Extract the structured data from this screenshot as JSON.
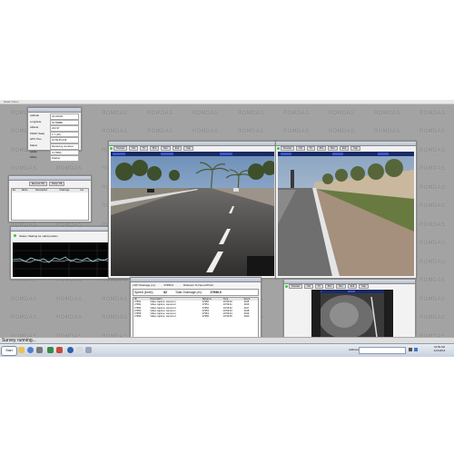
{
  "window": {
    "title": "Hawk Vision"
  },
  "watermark": "ROMDAS",
  "gps": {
    "rows": [
      {
        "label": "Latitude",
        "value": "24.3431N"
      },
      {
        "label": "Longitude",
        "value": "54.5998E"
      },
      {
        "label": "Altitude",
        "value": "243.97"
      },
      {
        "label": "PDOP (Sats)",
        "value": "1.7 (10)"
      },
      {
        "label": "GPS Time",
        "value": "10:59:45.246"
      },
      {
        "label": "Status",
        "value": "Receiving numbers"
      },
      {
        "label": "Lanes",
        "value": "3 (7000)"
      },
      {
        "label": "Offset",
        "value": "Flasher"
      }
    ]
  },
  "events": {
    "tabs": [
      "Element: PE",
      "Rutup: PE"
    ],
    "columns": [
      "Ev.",
      "Name",
      "Description",
      "Chainage",
      "Lat"
    ]
  },
  "status_window": {
    "status_text": "Status: Waiting for valid position"
  },
  "camera_left": {
    "buttons": [
      "Preview",
      "Vid",
      "Ttl",
      "Pho",
      "Rec",
      "Exit",
      "Cap"
    ]
  },
  "camera_right": {
    "buttons": [
      "Preview",
      "Vid",
      "Ttl",
      "Pho",
      "Rec",
      "Exit",
      "Cap"
    ]
  },
  "camera_bottom": {
    "buttons": [
      "Preview",
      "Vid",
      "Ttl",
      "Pho",
      "Rec",
      "Exit",
      "Cap"
    ]
  },
  "log": {
    "lsp_label": "LSP Chainage (m):",
    "lsp_value": "27956.0",
    "distance_label": "Distance To Next A/Point",
    "distance_value": "0",
    "speed_label": "Speed (km/h):",
    "speed_value": "62",
    "total_label": "Total Chainage (m):",
    "total_value": "27956.0",
    "columns": [
      "ID",
      "Description",
      "Distance",
      "Time",
      "Event"
    ],
    "rows": [
      {
        "id": "27951",
        "desc": "Video capture, camera 1",
        "dist": "27950",
        "time": "10:59:40",
        "event": "4015"
      },
      {
        "id": "27952",
        "desc": "Video capture, camera 2",
        "dist": "27951",
        "time": "10:59:41",
        "event": "4016"
      },
      {
        "id": "27953",
        "desc": "Video capture, camera 3",
        "dist": "27952",
        "time": "10:59:42",
        "event": "4017"
      },
      {
        "id": "27954",
        "desc": "Video capture, camera 1",
        "dist": "27953",
        "time": "10:59:43",
        "event": "4018"
      },
      {
        "id": "27955",
        "desc": "Video capture, camera 2",
        "dist": "27954",
        "time": "10:59:44",
        "event": "4019"
      },
      {
        "id": "27956",
        "desc": "Video capture, camera 3",
        "dist": "27955",
        "time": "10:59:45",
        "event": "4020"
      }
    ],
    "footer": "7:00:13:1111    27:01:39.7    Rutup file: 7000-0.3"
  },
  "statusbar": {
    "text": "Survey running..."
  },
  "taskbar": {
    "start_label": "Start",
    "address_label": "Address",
    "clock_time": "10:59 AM",
    "clock_date": "12/1/2013"
  },
  "colors": {
    "desktop": "#a3a3a3",
    "indicator_green": "#2ecc40",
    "trace_cyan": "#7fd7e8"
  }
}
